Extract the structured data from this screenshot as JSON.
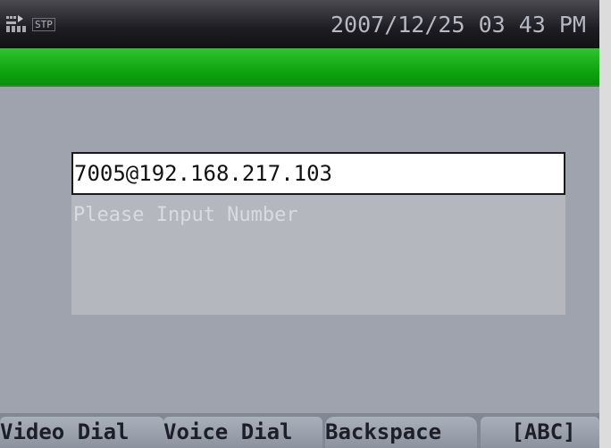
{
  "status_bar": {
    "protocol_badge": "STP",
    "datetime": "2007/12/25 03 43 PM",
    "icons": [
      "network-icon"
    ]
  },
  "dial_input": {
    "value": "7005@192.168.217.103",
    "hint": "Please Input Number"
  },
  "softkeys": [
    {
      "label": "Video Dial"
    },
    {
      "label": "Voice Dial"
    },
    {
      "label": "Backspace"
    },
    {
      "label": "[ABC]"
    }
  ],
  "colors": {
    "title_bar": "#11a511",
    "background": "#9ea3ad",
    "softkey_bar": "#808893"
  }
}
